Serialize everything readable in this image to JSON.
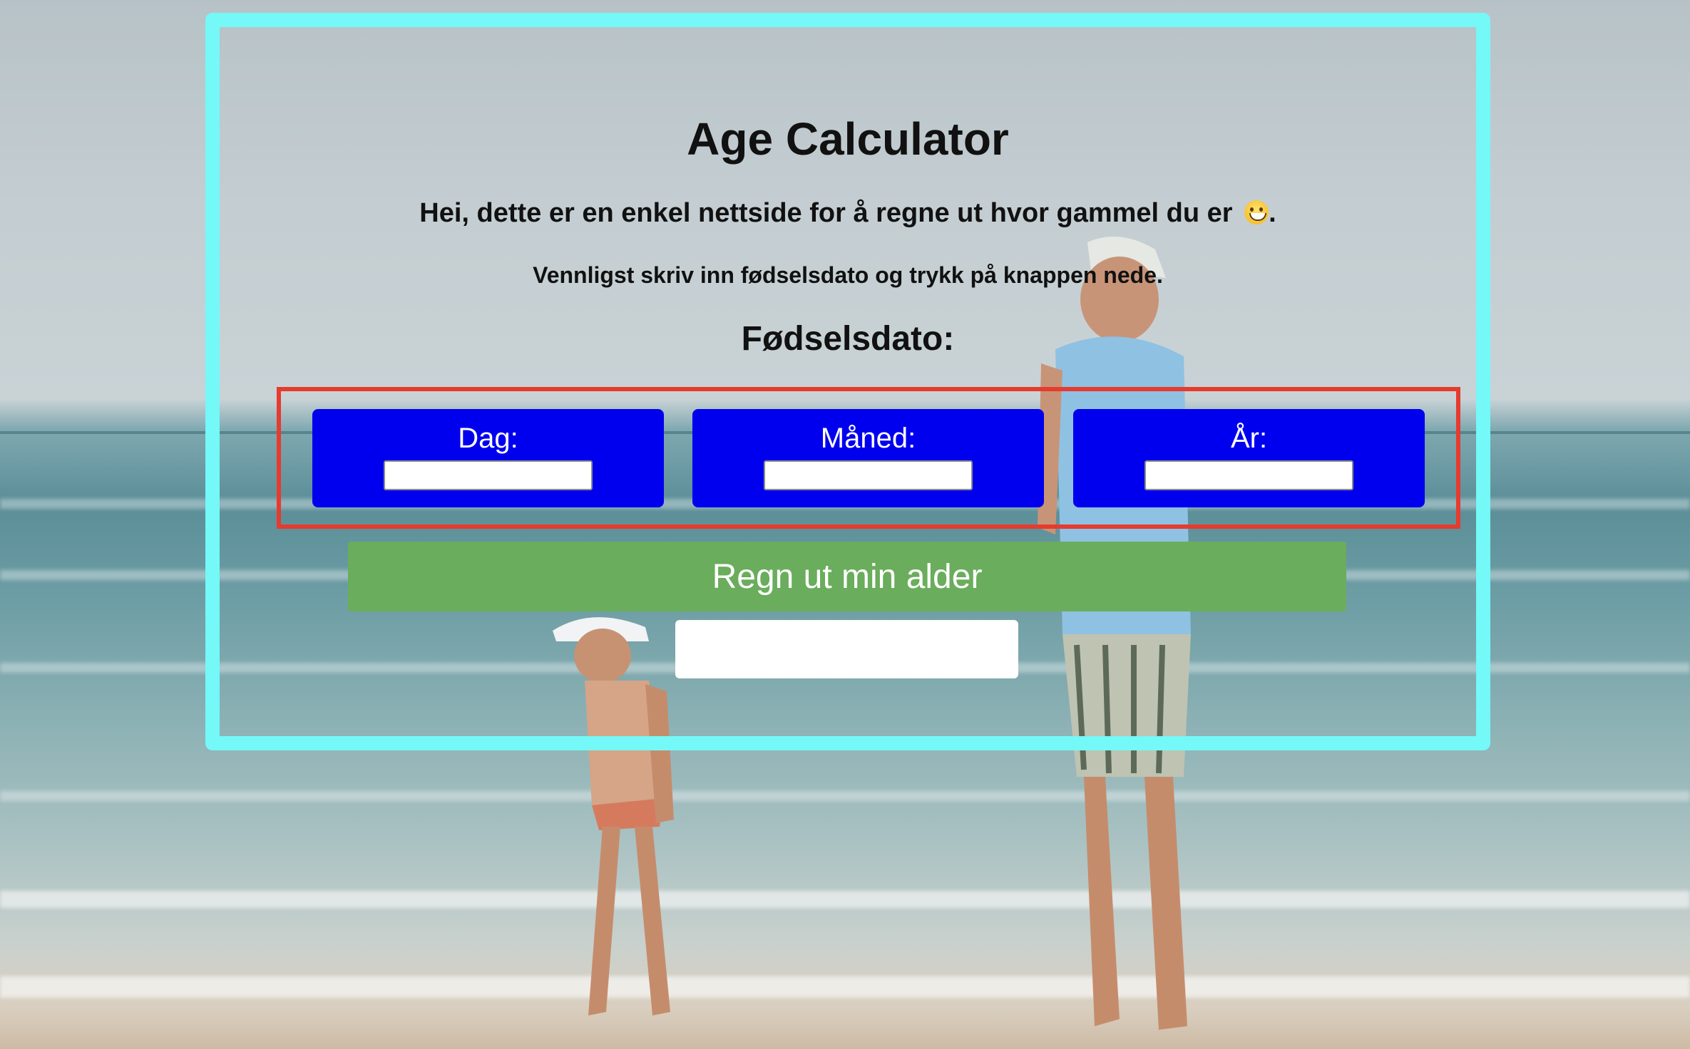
{
  "page": {
    "title": "Age Calculator",
    "intro_text": "Hei, dette er en enkel nettside for å regne ut hvor gammel du er",
    "intro_suffix": ".",
    "intro_emoji": "grinning-face-icon",
    "instruction": "Vennligst skriv inn fødselsdato og trykk på knappen nede.",
    "dob_heading": "Fødselsdato:"
  },
  "fields": [
    {
      "label": "Dag:",
      "value": ""
    },
    {
      "label": "Måned:",
      "value": ""
    },
    {
      "label": "År:",
      "value": ""
    }
  ],
  "button": {
    "label": "Regn ut min alder"
  },
  "result": {
    "text": ""
  },
  "colors": {
    "frame": "#74f8f8",
    "inputs_border": "#e63b2e",
    "field_card": "#0000ee",
    "button": "#6aad5c"
  }
}
